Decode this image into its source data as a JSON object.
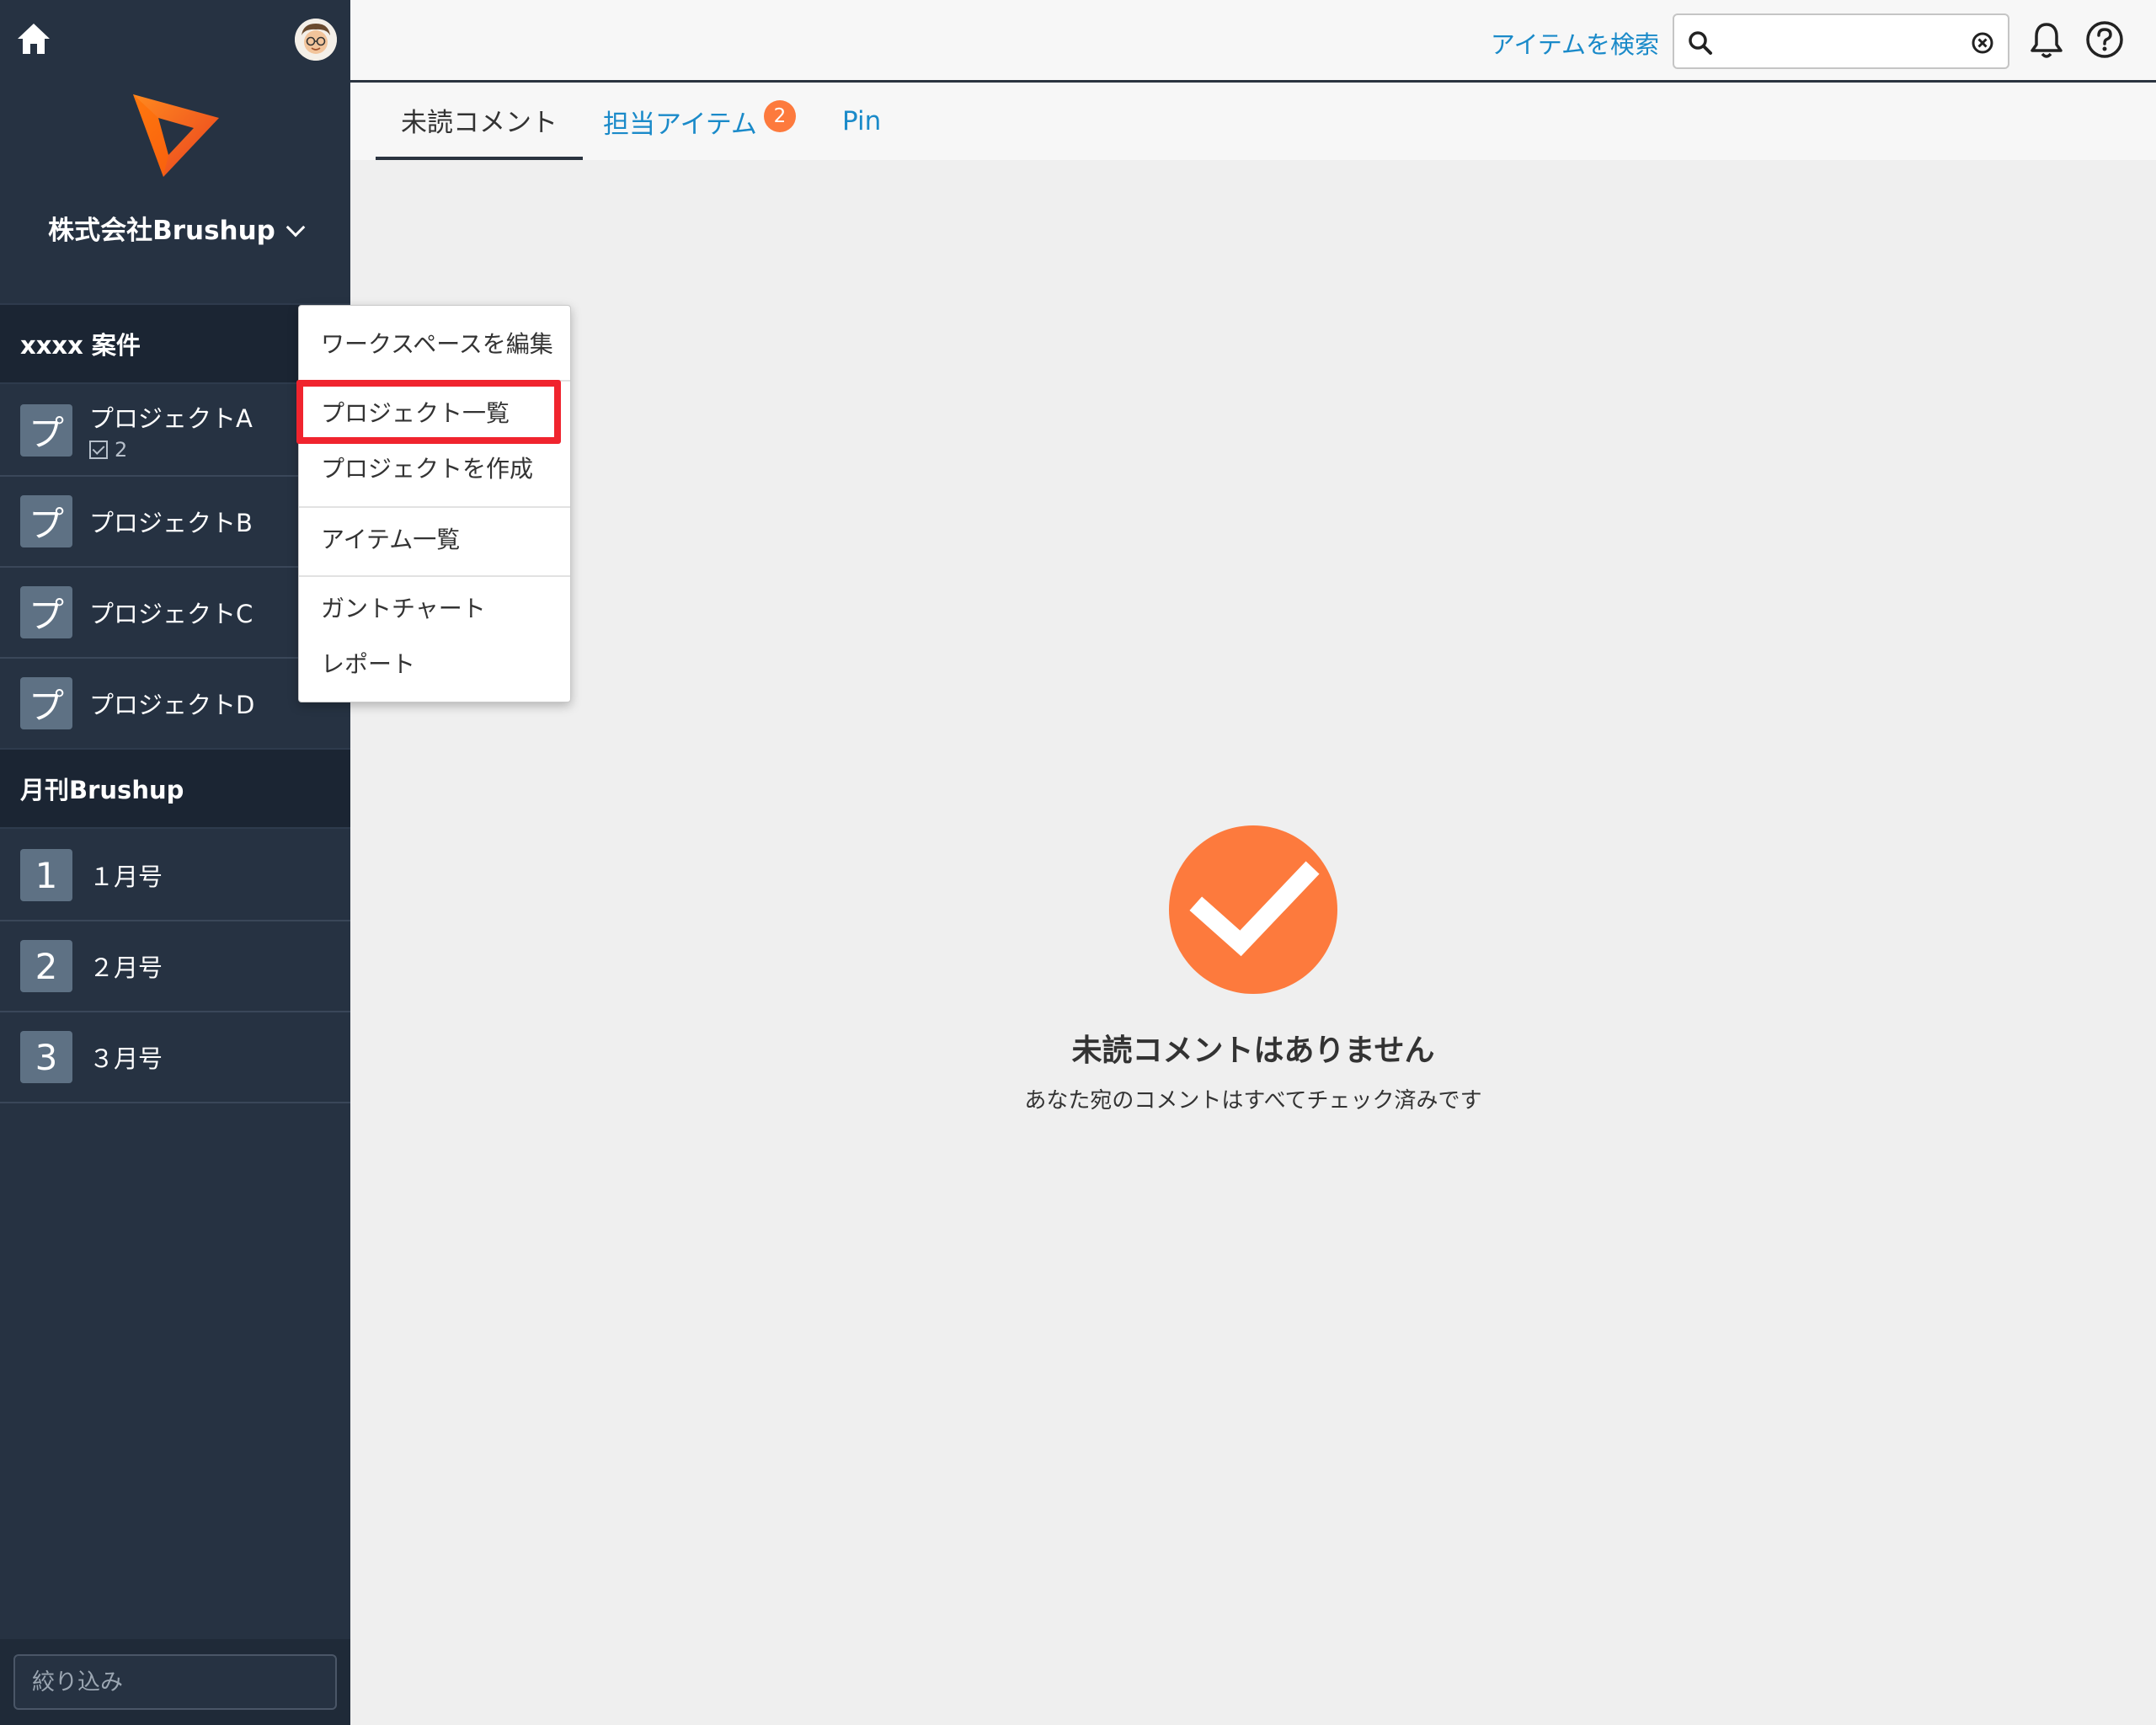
{
  "sidebar": {
    "org_name": "株式会社Brushup",
    "workspaces": [
      {
        "name": "xxxx 案件",
        "projects": [
          {
            "icon": "プ",
            "name": "プロジェクトA",
            "count": "2"
          },
          {
            "icon": "プ",
            "name": "プロジェクトB"
          },
          {
            "icon": "プ",
            "name": "プロジェクトC"
          },
          {
            "icon": "プ",
            "name": "プロジェクトD"
          }
        ]
      },
      {
        "name": "月刊Brushup",
        "projects": [
          {
            "icon": "1",
            "name": "１月号"
          },
          {
            "icon": "2",
            "name": "２月号"
          },
          {
            "icon": "3",
            "name": "３月号"
          }
        ]
      }
    ],
    "filter_placeholder": "絞り込み"
  },
  "header": {
    "search_link": "アイテムを検索",
    "search_value": ""
  },
  "tabs": [
    {
      "label": "未読コメント"
    },
    {
      "label": "担当アイテム",
      "badge": "2"
    },
    {
      "label": "Pin"
    }
  ],
  "menu": {
    "items": [
      "ワークスペースを編集",
      "プロジェクト一覧",
      "プロジェクトを作成",
      "アイテム一覧",
      "ガントチャート",
      "レポート"
    ]
  },
  "empty_state": {
    "title": "未読コメントはありません",
    "subtitle": "あなた宛のコメントはすべてチェック済みです"
  },
  "colors": {
    "sidebar_bg": "#263242",
    "accent_orange": "#fd7a3d",
    "link_blue": "#1a8ac9",
    "highlight_red": "#f0242e"
  }
}
